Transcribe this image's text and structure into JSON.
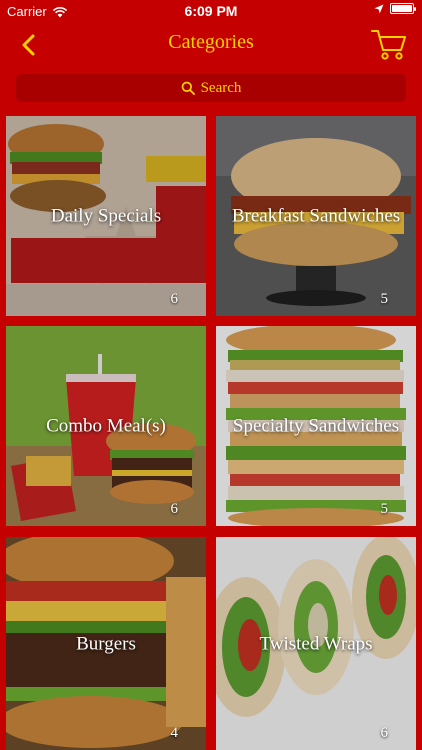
{
  "status_bar": {
    "carrier": "Carrier",
    "time": "6:09 PM"
  },
  "nav": {
    "title": "Categories",
    "back_icon": "chevron-left-icon",
    "cart_icon": "shopping-cart-icon"
  },
  "search": {
    "label": "Search",
    "icon": "search-icon"
  },
  "colors": {
    "background": "#c40000",
    "accent": "#ffd200",
    "search_bar": "#a80000"
  },
  "categories": [
    {
      "name": "Daily Specials",
      "count": "6"
    },
    {
      "name": "Breakfast Sandwiches",
      "count": "5"
    },
    {
      "name": "Combo Meal(s)",
      "count": "6"
    },
    {
      "name": "Specialty Sandwiches",
      "count": "5"
    },
    {
      "name": "Burgers",
      "count": "4"
    },
    {
      "name": "Twisted Wraps",
      "count": "6"
    }
  ]
}
